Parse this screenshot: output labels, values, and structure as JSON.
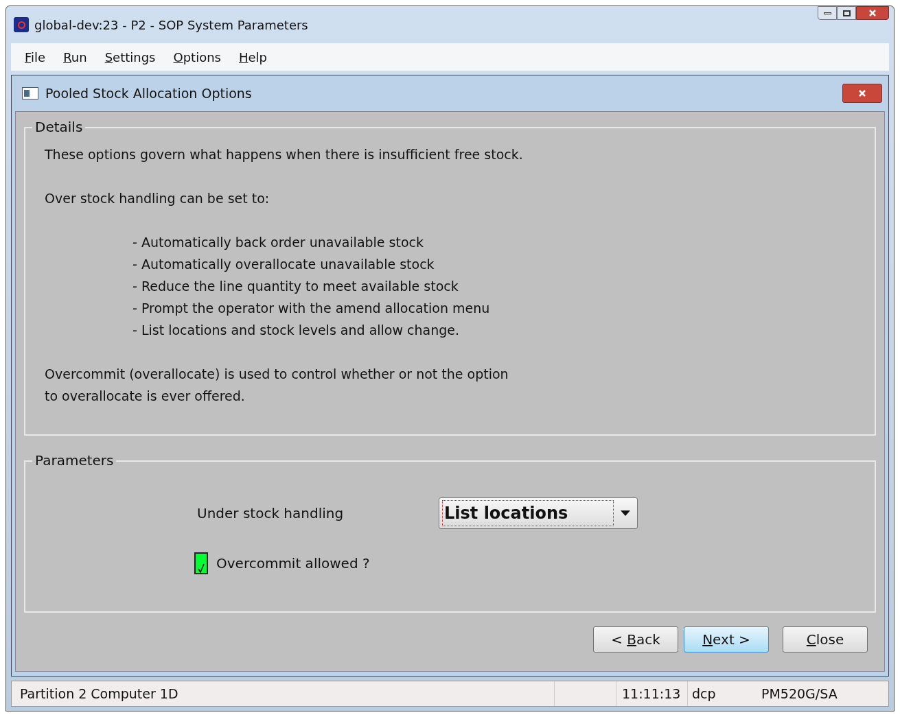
{
  "window": {
    "title": "global-dev:23 - P2 - SOP System Parameters"
  },
  "menu": [
    "File",
    "Run",
    "Settings",
    "Options",
    "Help"
  ],
  "dialog": {
    "title": "Pooled Stock Allocation Options"
  },
  "details": {
    "legend": "Details",
    "intro": "These options govern what happens when there is insufficient free stock.",
    "lead": "Over stock handling can be set to:",
    "options": [
      "- Automatically back order unavailable stock",
      "- Automatically overallocate unavailable stock",
      "- Reduce the line quantity to meet available stock",
      "- Prompt the operator with the amend allocation menu",
      "- List locations and stock levels and allow change."
    ],
    "note": [
      "Overcommit (overallocate) is used to control whether or not the option",
      "to overallocate is ever offered."
    ]
  },
  "parameters": {
    "legend": "Parameters",
    "under_stock_label": "Under stock handling",
    "under_stock_value": "List locations",
    "overcommit": {
      "label": "Overcommit allowed ?",
      "checked": true
    }
  },
  "buttons": [
    {
      "label": "< Back",
      "selected": false
    },
    {
      "label": "Next >",
      "selected": true
    },
    {
      "label": "Close",
      "selected": false
    }
  ],
  "status_bar": [
    "Partition 2 Computer 1D",
    "11:11:13",
    "dcp",
    "PM520G/SA"
  ]
}
